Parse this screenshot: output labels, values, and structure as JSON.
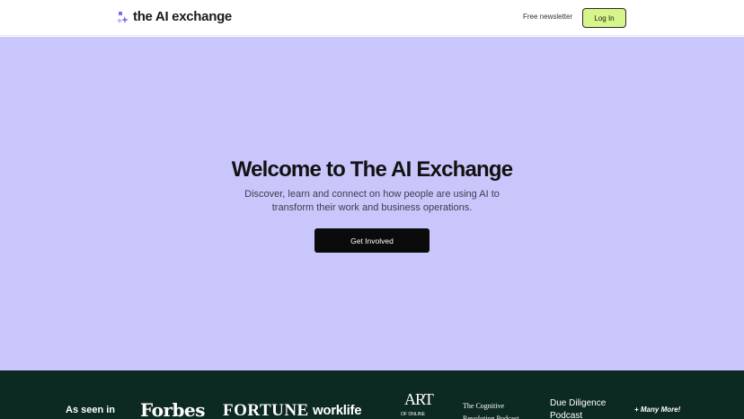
{
  "header": {
    "brand": "the AI exchange",
    "nav_newsletter": "Free newsletter",
    "login_label": "Log In"
  },
  "hero": {
    "title": "Welcome to The AI Exchange",
    "subtitle": "Discover, learn and connect on how people are using AI to transform their work and business operations.",
    "cta_label": "Get Involved"
  },
  "press": {
    "label": "As seen in",
    "outlets": {
      "forbes": "Forbes",
      "fortune": "FORTUNE",
      "worklife": "worklife",
      "art_big": "ART",
      "art_small": "OF ONLINE",
      "cognitive": "The Cognitive Revolution Podcast",
      "due_diligence": "Due Diligence Podcast",
      "more": "+ Many More!"
    }
  },
  "colors": {
    "hero_bg": "#c9c6fb",
    "login_bg": "#d6f58a",
    "press_bg": "#0d2a22",
    "cta_bg": "#0b0b0b",
    "logo_accent": "#7b6cf0"
  },
  "icons": {
    "logo": "sparkle-star-logo-icon"
  }
}
